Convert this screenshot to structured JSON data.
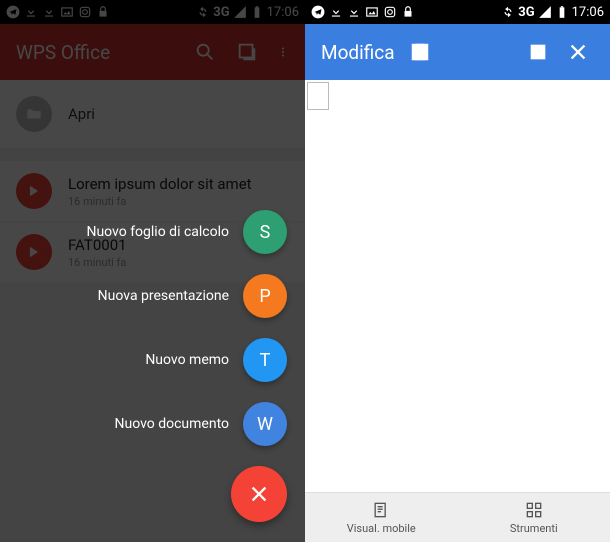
{
  "status": {
    "network": "3G",
    "time": "17:06"
  },
  "left": {
    "header": {
      "title": "WPS Office"
    },
    "open_label": "Apri",
    "documents": [
      {
        "title": "Lorem ipsum dolor sit amet",
        "subtitle": "16 minuti fa"
      },
      {
        "title": "FAT0001",
        "subtitle": "16 minuti fa"
      }
    ],
    "fab": {
      "items": [
        {
          "label": "Nuovo foglio di calcolo",
          "letter": "S",
          "color": "#2e9f73"
        },
        {
          "label": "Nuova presentazione",
          "letter": "P",
          "color": "#f5791f"
        },
        {
          "label": "Nuovo memo",
          "letter": "T",
          "color": "#2196f3"
        },
        {
          "label": "Nuovo documento",
          "letter": "W",
          "color": "#4184e0"
        }
      ]
    }
  },
  "right": {
    "header": {
      "title": "Modifica"
    },
    "bottom": {
      "view_label": "Visual. mobile",
      "tools_label": "Strumenti"
    }
  }
}
